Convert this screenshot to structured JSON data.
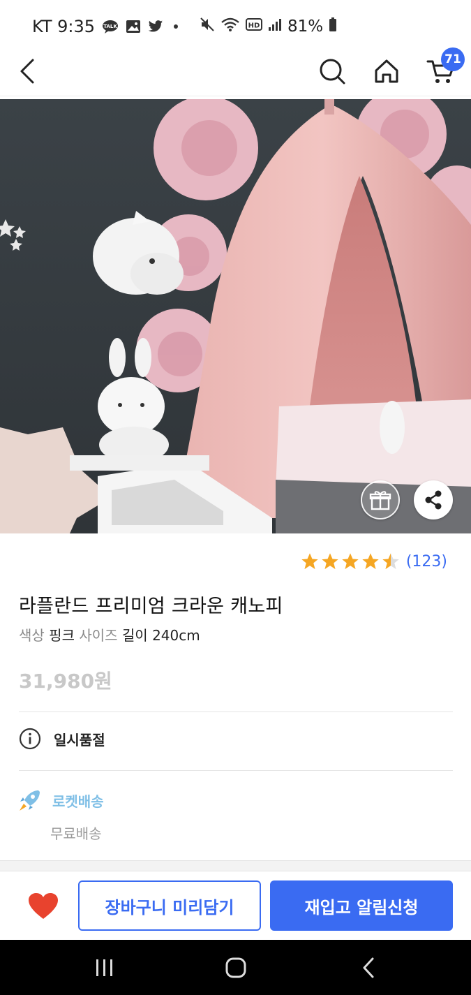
{
  "status": {
    "carrier_time": "KT 9:35",
    "battery": "81%"
  },
  "header": {
    "cart_count": "71"
  },
  "product": {
    "rating_count": "(123)",
    "rating_value": 4.5,
    "title": "라플란드 프리미엄 크라운 캐노피",
    "option_color_label": "색상",
    "option_color_value": "핑크",
    "option_size_label": "사이즈",
    "option_size_value": "길이 240cm",
    "price": "31,980원",
    "soldout": "일시품절",
    "delivery": "로켓배송",
    "shipping": "무료배송"
  },
  "actions": {
    "add_to_cart": "장바구니 미리담기",
    "restock_alert": "재입고 알림신청"
  },
  "colors": {
    "accent": "#3a6bf2",
    "star": "#f5a623",
    "heart": "#e8432e",
    "rocket": "#7fbfe6"
  }
}
